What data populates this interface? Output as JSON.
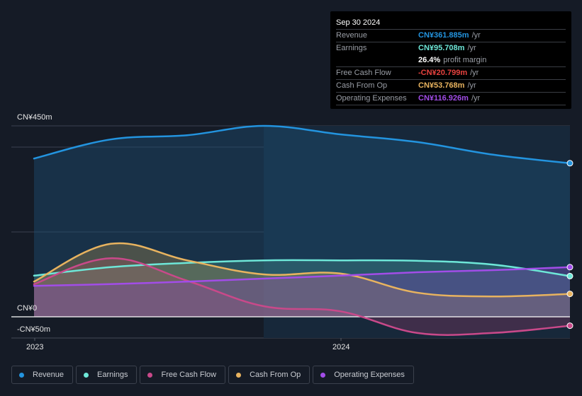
{
  "tooltip": {
    "date": "Sep 30 2024",
    "rows": [
      {
        "label": "Revenue",
        "value": "CN¥361.885m",
        "unit": "/yr",
        "color": "#2394df"
      },
      {
        "label": "Earnings",
        "value": "CN¥95.708m",
        "unit": "/yr",
        "color": "#6ee7d8"
      },
      {
        "label": "",
        "value": "26.4%",
        "unit": "profit margin",
        "color": "#ffffff"
      },
      {
        "label": "Free Cash Flow",
        "value": "-CN¥20.799m",
        "unit": "/yr",
        "color": "#e8423f"
      },
      {
        "label": "Cash From Op",
        "value": "CN¥53.768m",
        "unit": "/yr",
        "color": "#e8b35f"
      },
      {
        "label": "Operating Expenses",
        "value": "CN¥116.926m",
        "unit": "/yr",
        "color": "#a24de8"
      }
    ]
  },
  "chart_data": {
    "type": "area",
    "title": "",
    "xlabel": "",
    "ylabel": "",
    "y_unit": "CN¥m",
    "ylim": [
      -50,
      450
    ],
    "y_tick_labels": [
      {
        "value": 450,
        "label": "CN¥450m"
      },
      {
        "value": 0,
        "label": "CN¥0"
      },
      {
        "value": -50,
        "label": "-CN¥50m"
      }
    ],
    "gridlines": [
      450,
      400,
      200,
      0,
      -50
    ],
    "x": [
      "Dec 2022",
      "Mar 2023",
      "Jun 2023",
      "Sep 2023",
      "Dec 2023",
      "Mar 2024",
      "Jun 2024",
      "Sep 2024"
    ],
    "x_tick_labels": [
      {
        "index": 0,
        "label": "2023"
      },
      {
        "index": 4,
        "label": "2024"
      }
    ],
    "highlight_from_index": 3,
    "series": [
      {
        "name": "Revenue",
        "color": "#2394df",
        "values": [
          373,
          418,
          428,
          450,
          430,
          412,
          382,
          362
        ]
      },
      {
        "name": "Earnings",
        "color": "#6ee7d8",
        "values": [
          97,
          117,
          127,
          133,
          133,
          132,
          123,
          96
        ]
      },
      {
        "name": "Free Cash Flow",
        "color": "#c9498a",
        "values": [
          77,
          138,
          85,
          25,
          13,
          -38,
          -38,
          -21
        ]
      },
      {
        "name": "Cash From Op",
        "color": "#e8b35f",
        "values": [
          83,
          172,
          133,
          100,
          102,
          57,
          48,
          54
        ]
      },
      {
        "name": "Operating Expenses",
        "color": "#a24de8",
        "values": [
          73,
          77,
          83,
          90,
          97,
          105,
          110,
          117
        ]
      }
    ],
    "legend_position": "bottom-left"
  },
  "legend": [
    {
      "label": "Revenue",
      "color": "#2394df"
    },
    {
      "label": "Earnings",
      "color": "#6ee7d8"
    },
    {
      "label": "Free Cash Flow",
      "color": "#c9498a"
    },
    {
      "label": "Cash From Op",
      "color": "#e8b35f"
    },
    {
      "label": "Operating Expenses",
      "color": "#a24de8"
    }
  ]
}
